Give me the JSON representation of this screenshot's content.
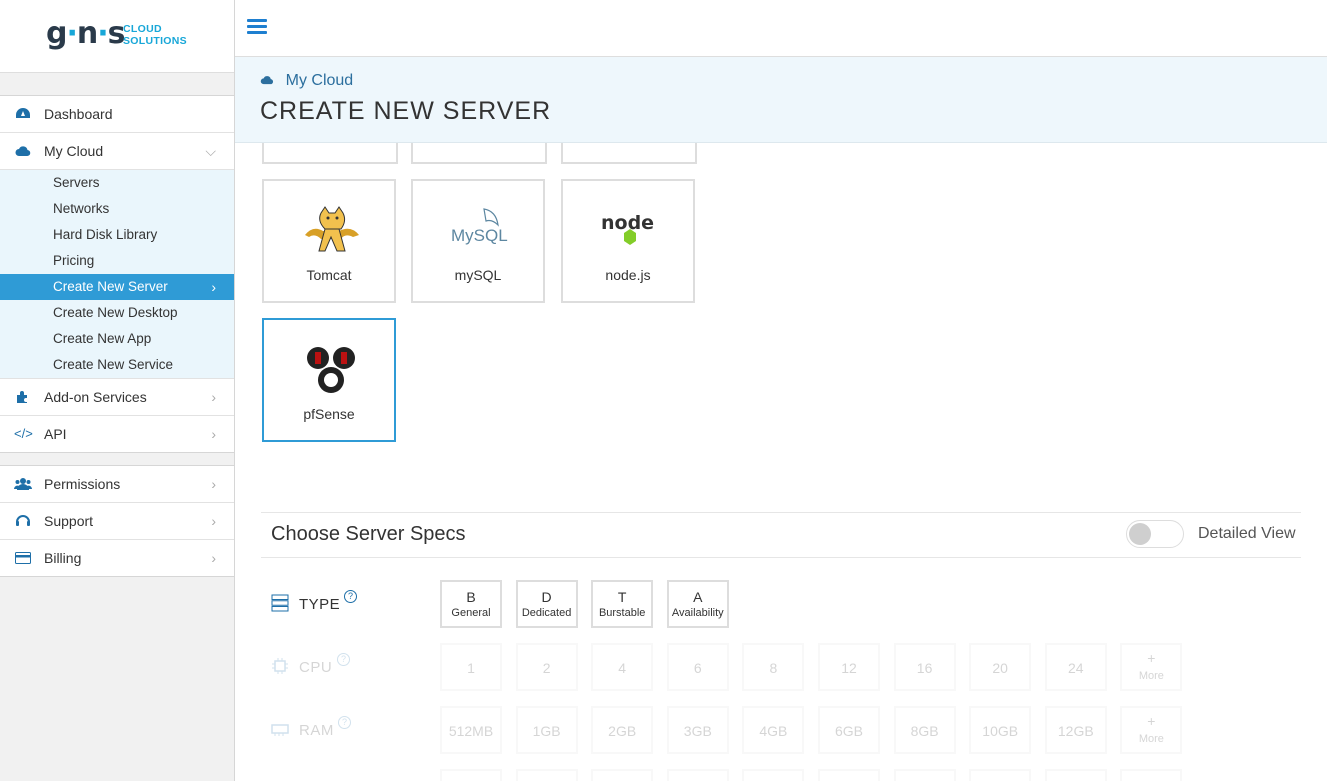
{
  "logo": {
    "mark": "g·n·s",
    "line1": "CLOUD",
    "line2": "SOLUTIONS"
  },
  "sidebar": {
    "dashboard": "Dashboard",
    "my_cloud": "My Cloud",
    "sub": [
      "Servers",
      "Networks",
      "Hard Disk Library",
      "Pricing",
      "Create New Server",
      "Create New Desktop",
      "Create New App",
      "Create New Service"
    ],
    "addon": "Add-on Services",
    "api": "API",
    "permissions": "Permissions",
    "support": "Support",
    "billing": "Billing"
  },
  "header": {
    "breadcrumb": "My Cloud",
    "title": "CREATE NEW SERVER"
  },
  "tiles": [
    "Tomcat",
    "mySQL",
    "node.js",
    "pfSense"
  ],
  "tile_art": {
    "mysql": "MySQL",
    "node": "node"
  },
  "specs": {
    "title": "Choose Server Specs",
    "toggle_label": "Detailed View",
    "type_label": "TYPE",
    "type_options": [
      {
        "code": "B",
        "name": "General"
      },
      {
        "code": "D",
        "name": "Dedicated"
      },
      {
        "code": "T",
        "name": "Burstable"
      },
      {
        "code": "A",
        "name": "Availability"
      }
    ],
    "cpu_label": "CPU",
    "cpu_options": [
      "1",
      "2",
      "4",
      "6",
      "8",
      "12",
      "16",
      "20",
      "24",
      "+"
    ],
    "cpu_more": "More",
    "ram_label": "RAM",
    "ram_options": [
      "512MB",
      "1GB",
      "2GB",
      "3GB",
      "4GB",
      "6GB",
      "8GB",
      "10GB",
      "12GB",
      "+"
    ],
    "ram_more": "More",
    "help": "?"
  },
  "colors": {
    "accent": "#2f9bd6",
    "brand": "#18a7d8",
    "header_bg": "#eef7fc"
  }
}
